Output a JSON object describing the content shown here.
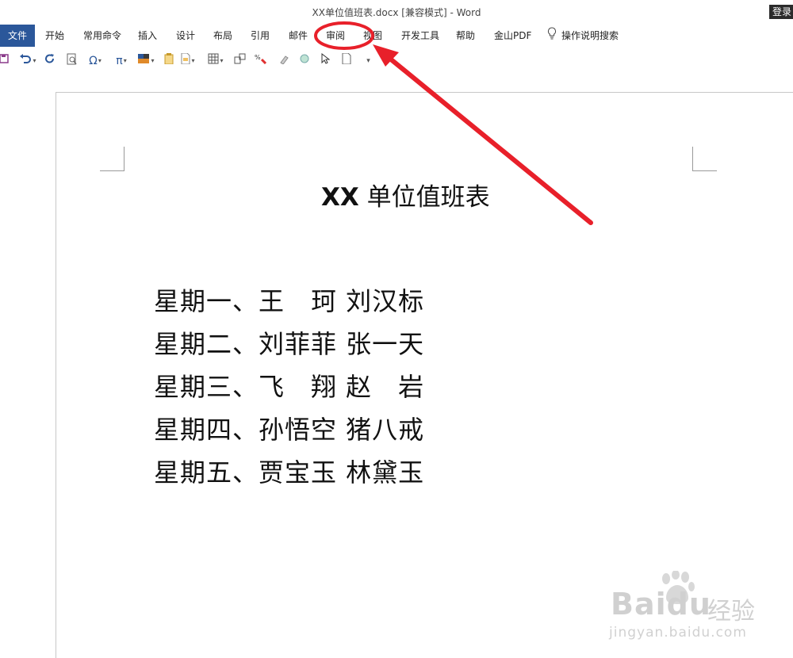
{
  "window": {
    "title": "XX单位值班表.docx [兼容模式]  -  Word",
    "login_label": "登录"
  },
  "ribbon": {
    "file_tab": "文件",
    "tabs": [
      "开始",
      "常用命令",
      "插入",
      "设计",
      "布局",
      "引用",
      "邮件",
      "审阅",
      "视图",
      "开发工具",
      "帮助",
      "金山PDF"
    ],
    "tell_me": "操作说明搜索"
  },
  "quick_access": {
    "icons": [
      "save-icon",
      "undo-icon",
      "redo-icon",
      "print-preview-icon",
      "symbol-omega-icon",
      "equation-pi-icon",
      "color-fill-icon",
      "paste-icon",
      "document-icon",
      "table-icon",
      "sort-icon",
      "format-painter-icon",
      "highlight-icon",
      "shape-circle-icon",
      "select-pointer-icon",
      "new-page-icon",
      "customize-dropdown-icon"
    ],
    "symbol_glyph": "Ω",
    "pi_glyph": "π"
  },
  "document": {
    "heading_prefix": "XX",
    "heading_text": " 单位值班表",
    "lines": [
      "星期一、王　珂 刘汉标",
      "星期二、刘菲菲 张一天",
      "星期三、飞　翔 赵　岩",
      "星期四、孙悟空 猪八戒",
      "星期五、贾宝玉 林黛玉"
    ]
  },
  "watermark": {
    "brand": "Bai",
    "brand_suffix": "du",
    "cn": "经验",
    "url": "jingyan.baidu.com"
  },
  "annotation": {
    "color": "#e8202a",
    "target_tab": "审阅"
  }
}
